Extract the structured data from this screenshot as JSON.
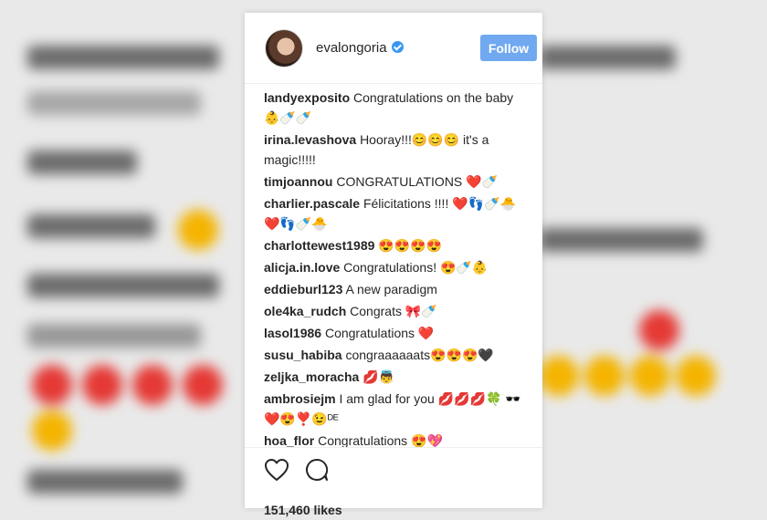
{
  "post": {
    "username": "evalongoria",
    "follow_label": "Follow",
    "likes": "151,460 likes"
  },
  "comments": [
    {
      "user": "landyexposito",
      "text": "Congratulations on the baby 👶🍼🍼"
    },
    {
      "user": "irina.levashova",
      "text": "Hooray!!!😊😊😊 it's a magic!!!!!"
    },
    {
      "user": "timjoannou",
      "text": "CONGRATULATIONS ❤️🍼"
    },
    {
      "user": "charlier.pascale",
      "text": "Félicitations !!!! ❤️👣🍼🐣 ❤️👣🍼🐣"
    },
    {
      "user": "charlottewest1989",
      "text": "😍😍😍😍"
    },
    {
      "user": "alicja.in.love",
      "text": "Congratulations! 😍🍼👶"
    },
    {
      "user": "eddieburl123",
      "text": "A new paradigm"
    },
    {
      "user": "ole4ka_rudch",
      "text": "Congrats 🎀🍼"
    },
    {
      "user": "lasol1986",
      "text": "Congratulations ❤️"
    },
    {
      "user": "susu_habiba",
      "text": "congraaaaaats😍😍😍🖤"
    },
    {
      "user": "zeljka_moracha",
      "text": "💋👼"
    },
    {
      "user": "ambrosiejm",
      "text": "I am glad for you 💋💋💋🍀 🕶️❤️😍❣️😉ᴰᴱ"
    },
    {
      "user": "hoa_flor",
      "text": "Congratulations 😍💖"
    }
  ],
  "icons": {
    "like": "heart-outline-icon",
    "comment": "comment-bubble-icon"
  }
}
